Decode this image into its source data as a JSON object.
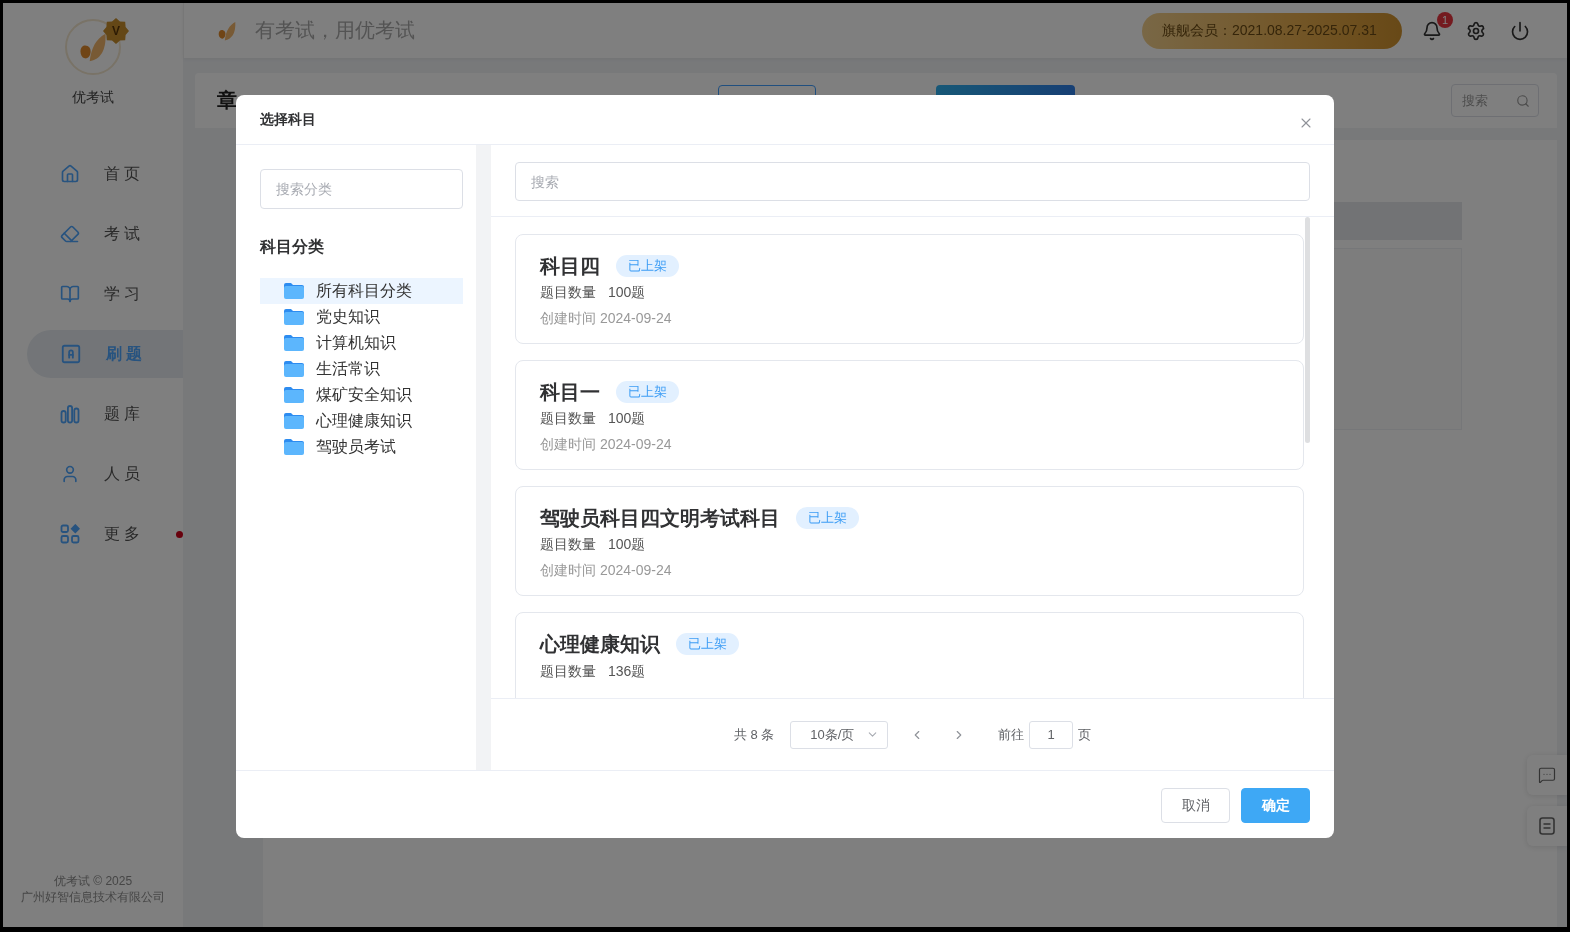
{
  "sidebar": {
    "logo": {
      "badge": "V"
    },
    "brand": "优考试",
    "items": [
      {
        "label": "首页",
        "selected": false,
        "dot": false
      },
      {
        "label": "考试",
        "selected": false,
        "dot": false
      },
      {
        "label": "学习",
        "selected": false,
        "dot": false
      },
      {
        "label": "刷题",
        "selected": true,
        "dot": false
      },
      {
        "label": "题库",
        "selected": false,
        "dot": false
      },
      {
        "label": "人员",
        "selected": false,
        "dot": false
      },
      {
        "label": "更多",
        "selected": false,
        "dot": true
      }
    ],
    "footer": [
      "优考试 © 2025",
      "广州好智信息技术有限公司"
    ]
  },
  "header": {
    "slogan": "有考试，用优考试",
    "membership": "旗舰会员：2021.08.27-2025.07.31",
    "notifications": "1"
  },
  "page": {
    "title": "章",
    "search": {
      "placeholder": "搜索"
    }
  },
  "dialog": {
    "title": "选择科目",
    "category_search": {
      "placeholder": "搜索分类"
    },
    "category_heading": "科目分类",
    "categories": [
      {
        "label": "所有科目分类",
        "selected": true
      },
      {
        "label": "党史知识",
        "selected": false
      },
      {
        "label": "计算机知识",
        "selected": false
      },
      {
        "label": "生活常识",
        "selected": false
      },
      {
        "label": "煤矿安全知识",
        "selected": false
      },
      {
        "label": "心理健康知识",
        "selected": false
      },
      {
        "label": "驾驶员考试",
        "selected": false
      }
    ],
    "subject_search": {
      "placeholder": "搜索"
    },
    "subjects": [
      {
        "name": "科目四",
        "status": "已上架",
        "count_label": "题目数量",
        "count": "100题",
        "created": "创建时间 2024-09-24"
      },
      {
        "name": "科目一",
        "status": "已上架",
        "count_label": "题目数量",
        "count": "100题",
        "created": "创建时间 2024-09-24"
      },
      {
        "name": "驾驶员科目四文明考试科目",
        "status": "已上架",
        "count_label": "题目数量",
        "count": "100题",
        "created": "创建时间 2024-09-24"
      },
      {
        "name": "心理健康知识",
        "status": "已上架",
        "count_label": "题目数量",
        "count": "136题"
      }
    ],
    "pagination": {
      "total": "共 8 条",
      "page_size": "10条/页",
      "goto_label": "前往",
      "page": "1",
      "page_suffix": "页"
    },
    "buttons": [
      {
        "label": "取消",
        "kind": "default"
      },
      {
        "label": "确定",
        "kind": "primary"
      }
    ]
  }
}
